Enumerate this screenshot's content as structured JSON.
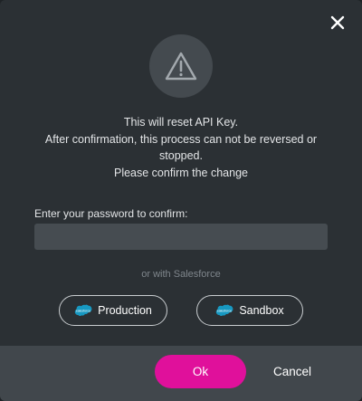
{
  "dialog": {
    "message_lines": [
      "This will reset API Key.",
      "After confirmation, this process can not be reversed or",
      "stopped.",
      "Please confirm the change"
    ],
    "password_label": "Enter your password to confirm:",
    "password_value": "",
    "password_placeholder": "",
    "or_text": "or with Salesforce",
    "production_label": "Production",
    "sandbox_label": "Sandbox",
    "ok_label": "Ok",
    "cancel_label": "Cancel"
  },
  "icons": {
    "close": "close-icon",
    "warning": "warning-triangle-icon",
    "salesforce": "salesforce-cloud-icon"
  },
  "colors": {
    "dialog_bg": "#2b3034",
    "footer_bg": "#41474c",
    "input_bg": "#464c51",
    "ok_accent": "#e0109b",
    "salesforce_blue": "#1798c1"
  }
}
